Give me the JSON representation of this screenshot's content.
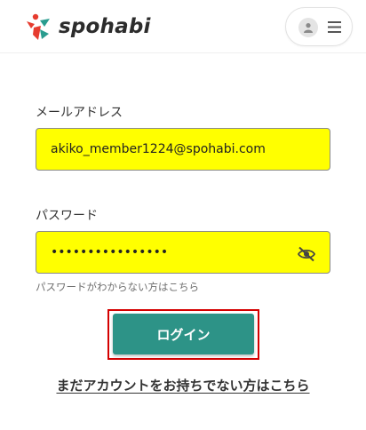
{
  "header": {
    "logo_text": "spohabi",
    "brand_colors": {
      "red": "#e63c2f",
      "teal": "#2a9d8f"
    }
  },
  "form": {
    "email_label": "メールアドレス",
    "email_value": "akiko_member1224@spohabi.com",
    "password_label": "パスワード",
    "password_value": "••••••••••••••••",
    "forgot_password_text": "パスワードがわからない方はこちら",
    "field_highlight_color": "#ffff00",
    "password_toggle_icon": "eye-off-icon"
  },
  "actions": {
    "login_label": "ログイン",
    "login_color": "#2d9387",
    "signup_link_text": "まだアカウントをお持ちでない方はこちら"
  }
}
